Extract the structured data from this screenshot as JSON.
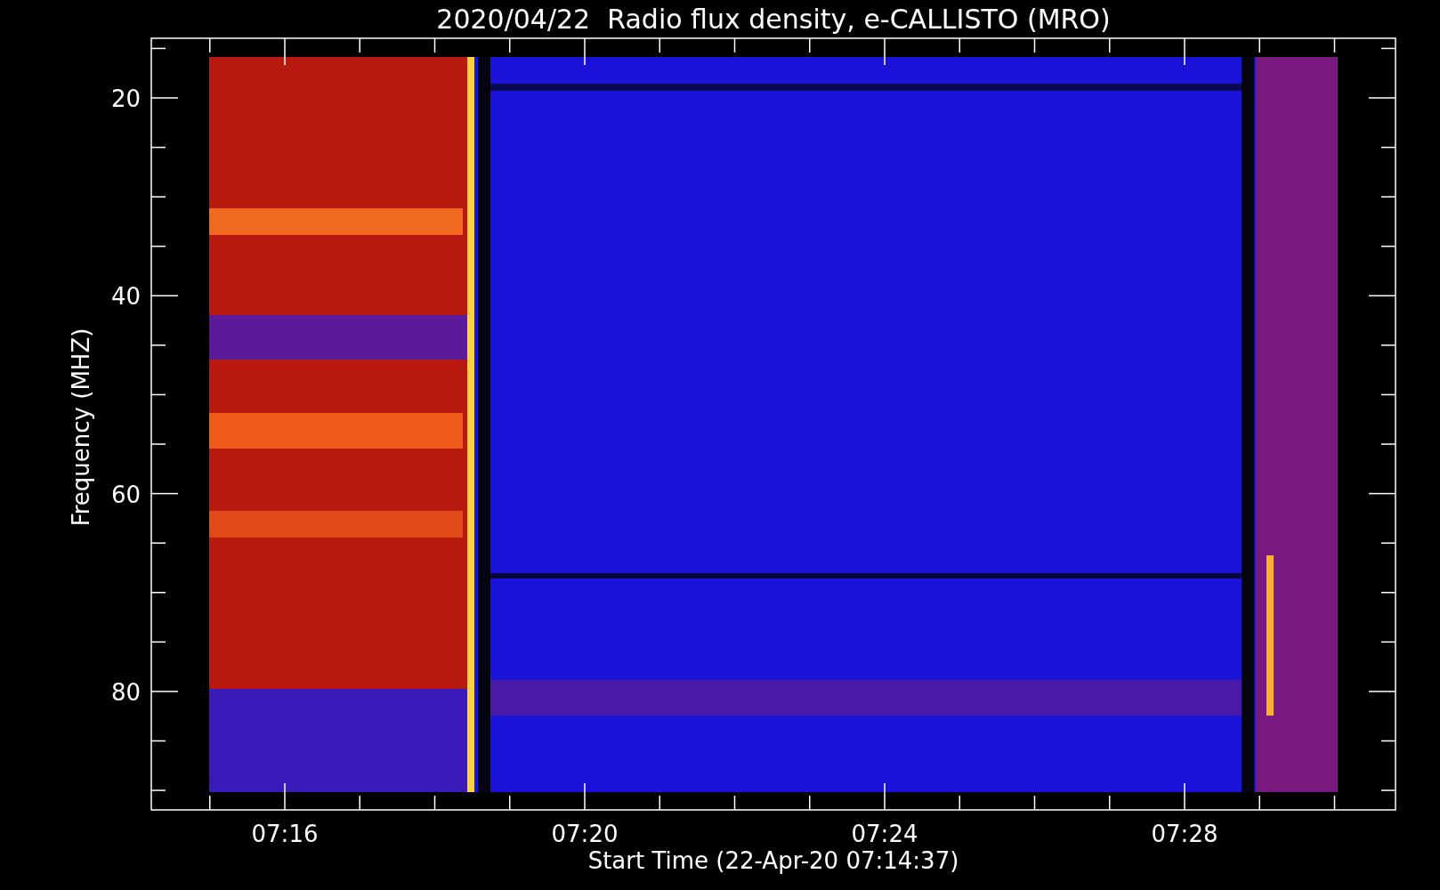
{
  "title": "2020/04/22  Radio flux density, e-CALLISTO (MRO)",
  "y_axis": {
    "label": "Frequency (MHZ)",
    "ticks": [
      "20",
      "40",
      "60",
      "80"
    ]
  },
  "x_axis": {
    "label": "Start Time (22-Apr-20 07:14:37)",
    "ticks": [
      "07:16",
      "07:20",
      "07:24",
      "07:28"
    ]
  }
}
